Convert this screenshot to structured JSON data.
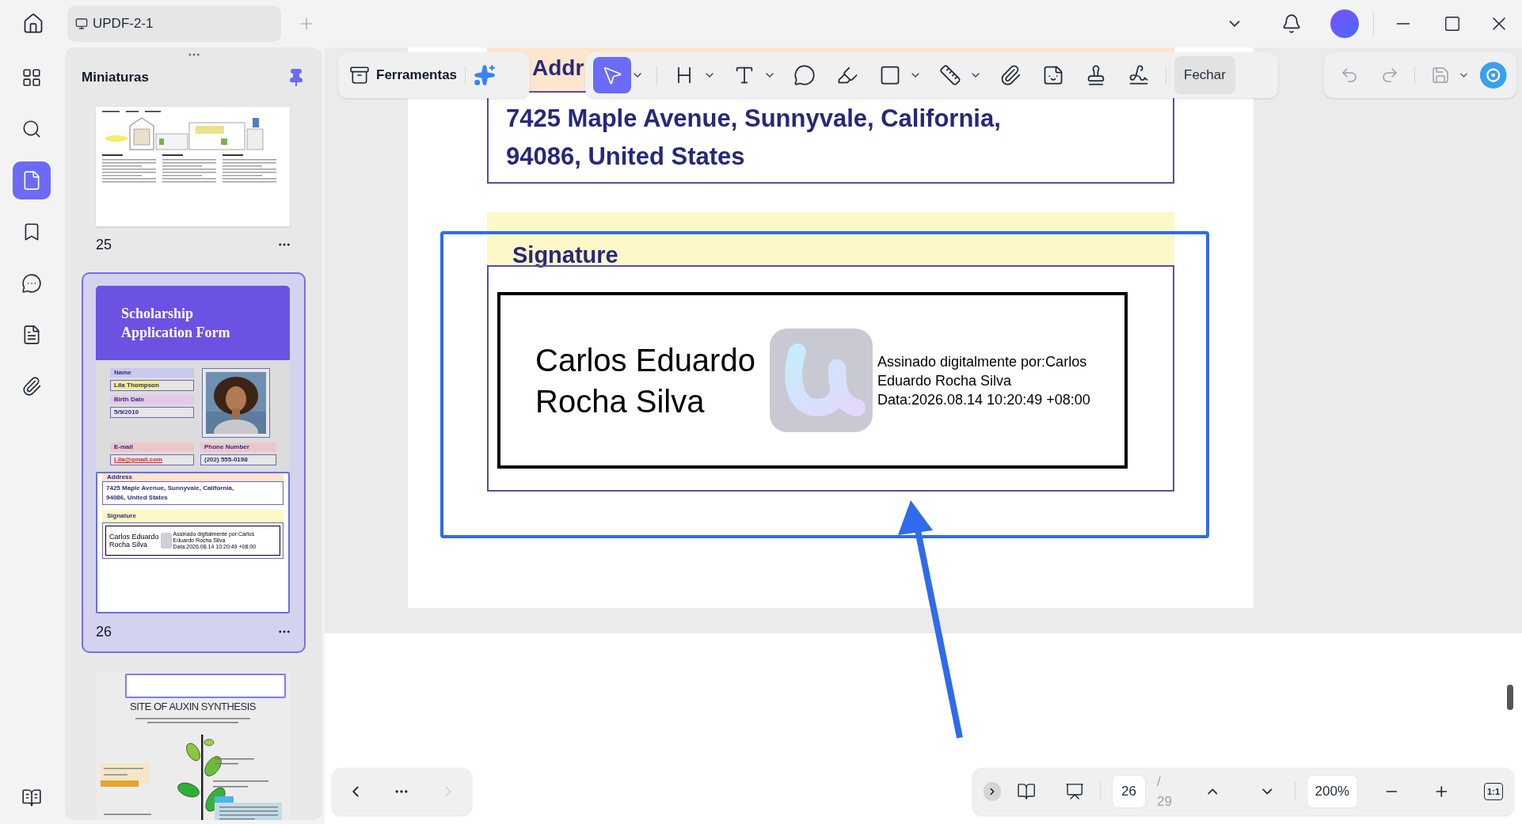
{
  "titlebar": {
    "tab_title": "UPDF-2-1"
  },
  "rail": {
    "items": [
      {
        "kind": "grid",
        "selected": false
      },
      {
        "kind": "search",
        "selected": false
      },
      {
        "kind": "pages",
        "selected": true
      },
      {
        "kind": "bookmark",
        "selected": false
      },
      {
        "kind": "comment",
        "selected": false
      },
      {
        "kind": "form",
        "selected": false
      },
      {
        "kind": "attachment",
        "selected": false
      }
    ]
  },
  "sidebar": {
    "title": "Miniaturas",
    "pinned": true,
    "thumbnails": [
      {
        "kind": "zoning",
        "page": "25",
        "selected": false
      },
      {
        "kind": "form",
        "page": "26",
        "selected": true,
        "title_lines": [
          "Scholarship",
          "Application Form"
        ],
        "fields": [
          {
            "label": "Name",
            "value": "Lila Thompson",
            "color": "#c9c9ee",
            "kind": "highlight"
          },
          {
            "label": "Birth Date",
            "value": "5/9/2010",
            "color": "#e6c9e9",
            "kind": "plain"
          },
          {
            "label": "E-mail",
            "value": "Lila@gmail.com",
            "color": "#edc6cc",
            "kind": "link"
          },
          {
            "label": "Phone Number",
            "value": "(202) 555-0198",
            "color": "#edc6cc",
            "kind": "plain"
          }
        ],
        "address_label": "Address",
        "address_lines": [
          "7425 Maple Avenue, Sunnyvale, California,",
          "94086, United States"
        ],
        "signature_label": "Signature",
        "signer_lines": [
          "Carlos Eduardo",
          "Rocha Silva"
        ],
        "detail_lines": [
          "Assinado digitalmente por:Carlos",
          "Eduardo Rocha Silva",
          "Data:2026.08.14 10:20:49 +08:00"
        ]
      },
      {
        "kind": "auxin",
        "selected": false,
        "title": "SITE OF AUXIN SYNTHESIS"
      }
    ]
  },
  "toolbar": {
    "label": "Ferramentas",
    "tools": [
      {
        "kind": "select",
        "selected": true,
        "menu": true
      },
      {
        "kind": "heading",
        "selected": false,
        "menu": true
      },
      {
        "kind": "text",
        "selected": false,
        "menu": true
      },
      {
        "kind": "comment",
        "selected": false,
        "menu": false
      },
      {
        "kind": "highlight",
        "selected": false,
        "menu": false
      },
      {
        "kind": "shape",
        "selected": false,
        "menu": true
      },
      {
        "kind": "measure",
        "selected": false,
        "menu": true
      },
      {
        "kind": "attach",
        "selected": false,
        "menu": false
      },
      {
        "kind": "sticker",
        "selected": false,
        "menu": false
      },
      {
        "kind": "stamp",
        "selected": false,
        "menu": false
      },
      {
        "kind": "sign",
        "selected": false,
        "menu": false
      }
    ],
    "close": "Fechar"
  },
  "history": [
    {
      "kind": "undo",
      "disabled": true
    },
    {
      "kind": "redo",
      "disabled": true
    },
    {
      "kind": "save",
      "disabled": true
    }
  ],
  "document": {
    "address_label": "Addr",
    "address_lines": [
      "7425 Maple Avenue, Sunnyvale, California,",
      "94086, United States"
    ],
    "signature_label": "Signature",
    "signer_lines": [
      "Carlos Eduardo",
      "Rocha Silva"
    ],
    "detail_lines": [
      "Assinado digitalmente por:Carlos",
      "Eduardo Rocha Silva",
      "Data:2026.08.14 10:20:49 +08:00"
    ]
  },
  "pager": {
    "page": "26",
    "total": "/ 29",
    "zoom": "200%",
    "fit": "1:1"
  }
}
